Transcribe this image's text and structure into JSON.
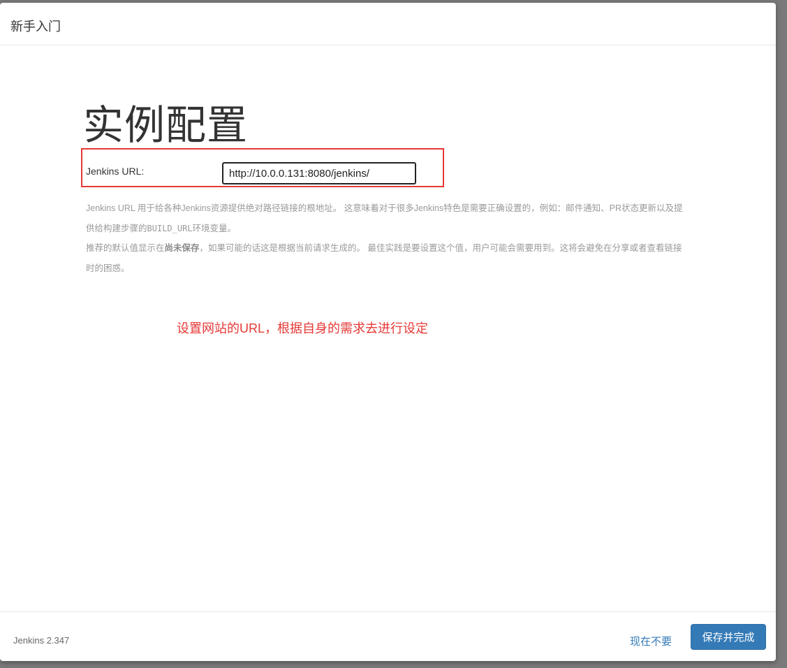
{
  "dialog": {
    "title": "新手入门"
  },
  "main": {
    "heading": "实例配置",
    "url_field": {
      "label": "Jenkins URL:",
      "value": "http://10.0.0.131:8080/jenkins/"
    },
    "help": {
      "line1_part1": "Jenkins URL 用于给各种Jenkins资源提供绝对路径链接的根地址。 这意味着对于很多Jenkins特色是需要正确设置的，例如：邮件通知、PR状态更新以及提供给构建步骤的",
      "line1_code": "BUILD_URL",
      "line1_part2": "环境变量。",
      "line2_part1": "推荐的默认值显示在",
      "line2_bold": "尚未保存",
      "line2_part2": "，如果可能的话这是根据当前请求生成的。 最佳实践是要设置这个值，用户可能会需要用到。这将会避免在分享或者查看链接时的困惑。"
    },
    "annotation": "设置网站的URL，根据自身的需求去进行设定"
  },
  "footer": {
    "version": "Jenkins 2.347",
    "skip_label": "现在不要",
    "save_label": "保存并完成"
  },
  "colors": {
    "accent": "#337ab7",
    "highlight": "#e53935"
  }
}
